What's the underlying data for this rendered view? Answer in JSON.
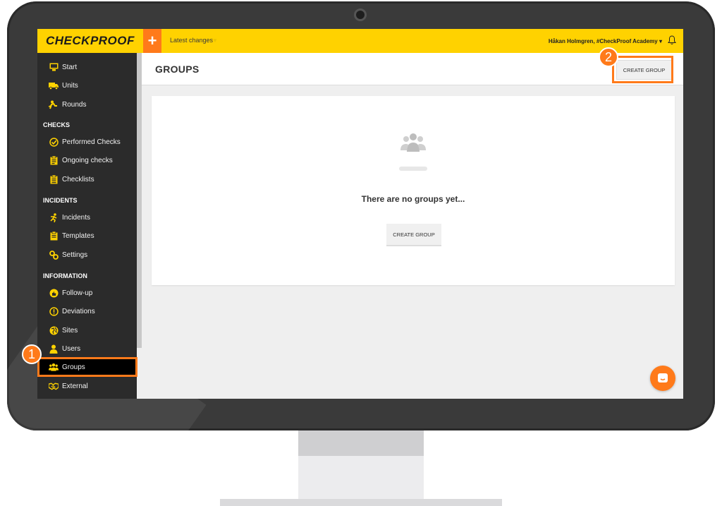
{
  "topbar": {
    "logo_text": "CHECKPROOF",
    "plus_label": "+",
    "latest_changes": "Latest changes",
    "user_menu": "Håkan Holmgren, #CheckProof Academy",
    "accent_color": "#ffd200",
    "orange_color": "#ff7a1a"
  },
  "sidebar": {
    "items_top": [
      {
        "label": "Start",
        "icon": "monitor-icon"
      },
      {
        "label": "Units",
        "icon": "truck-icon"
      },
      {
        "label": "Rounds",
        "icon": "rounds-icon"
      }
    ],
    "sections": [
      {
        "title": "CHECKS",
        "items": [
          {
            "label": "Performed Checks",
            "icon": "check-circle-icon"
          },
          {
            "label": "Ongoing checks",
            "icon": "clipboard-icon"
          },
          {
            "label": "Checklists",
            "icon": "checklist-icon"
          }
        ]
      },
      {
        "title": "INCIDENTS",
        "items": [
          {
            "label": "Incidents",
            "icon": "person-falling-icon"
          },
          {
            "label": "Templates",
            "icon": "template-icon"
          },
          {
            "label": "Settings",
            "icon": "gear-icon"
          }
        ]
      },
      {
        "title": "INFORMATION",
        "items": [
          {
            "label": "Follow-up",
            "icon": "thumbs-up-icon"
          },
          {
            "label": "Deviations",
            "icon": "exclamation-icon"
          },
          {
            "label": "Sites",
            "icon": "globe-icon"
          },
          {
            "label": "Users",
            "icon": "user-icon"
          },
          {
            "label": "Groups",
            "icon": "group-icon",
            "active": true
          },
          {
            "label": "External",
            "icon": "handshake-icon"
          }
        ]
      }
    ]
  },
  "header": {
    "title": "GROUPS",
    "create_button": "CREATE GROUP"
  },
  "empty_state": {
    "message": "There are no groups yet...",
    "create_button": "CREATE GROUP"
  },
  "annotations": {
    "step1": "1",
    "step2": "2"
  }
}
